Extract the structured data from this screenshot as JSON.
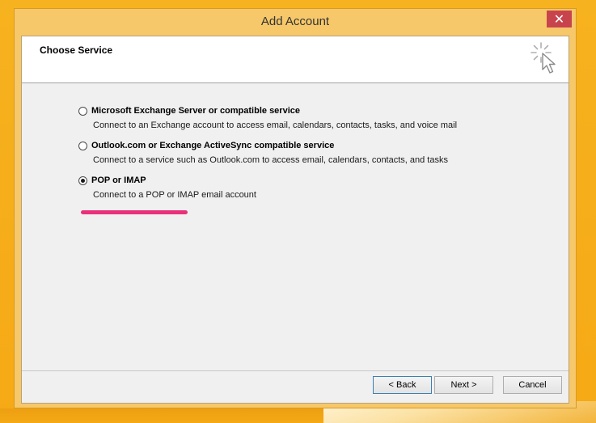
{
  "window": {
    "title": "Add Account",
    "close_label": "✕"
  },
  "header": {
    "title": "Choose Service"
  },
  "options": [
    {
      "label": "Microsoft Exchange Server or compatible service",
      "description": "Connect to an Exchange account to access email, calendars, contacts, tasks, and voice mail",
      "selected": false
    },
    {
      "label": "Outlook.com or Exchange ActiveSync compatible service",
      "description": "Connect to a service such as Outlook.com to access email, calendars, contacts, and tasks",
      "selected": false
    },
    {
      "label": "POP or IMAP",
      "description": "Connect to a POP or IMAP email account",
      "selected": true
    }
  ],
  "buttons": {
    "back": "< Back",
    "next": "Next >",
    "cancel": "Cancel"
  },
  "colors": {
    "desktop": "#f5a915",
    "window_frame": "#f6c86a",
    "close_button": "#c8444d",
    "highlight_mark": "#e8317a"
  },
  "icons": {
    "wizard": "wizard-cursor-icon"
  }
}
